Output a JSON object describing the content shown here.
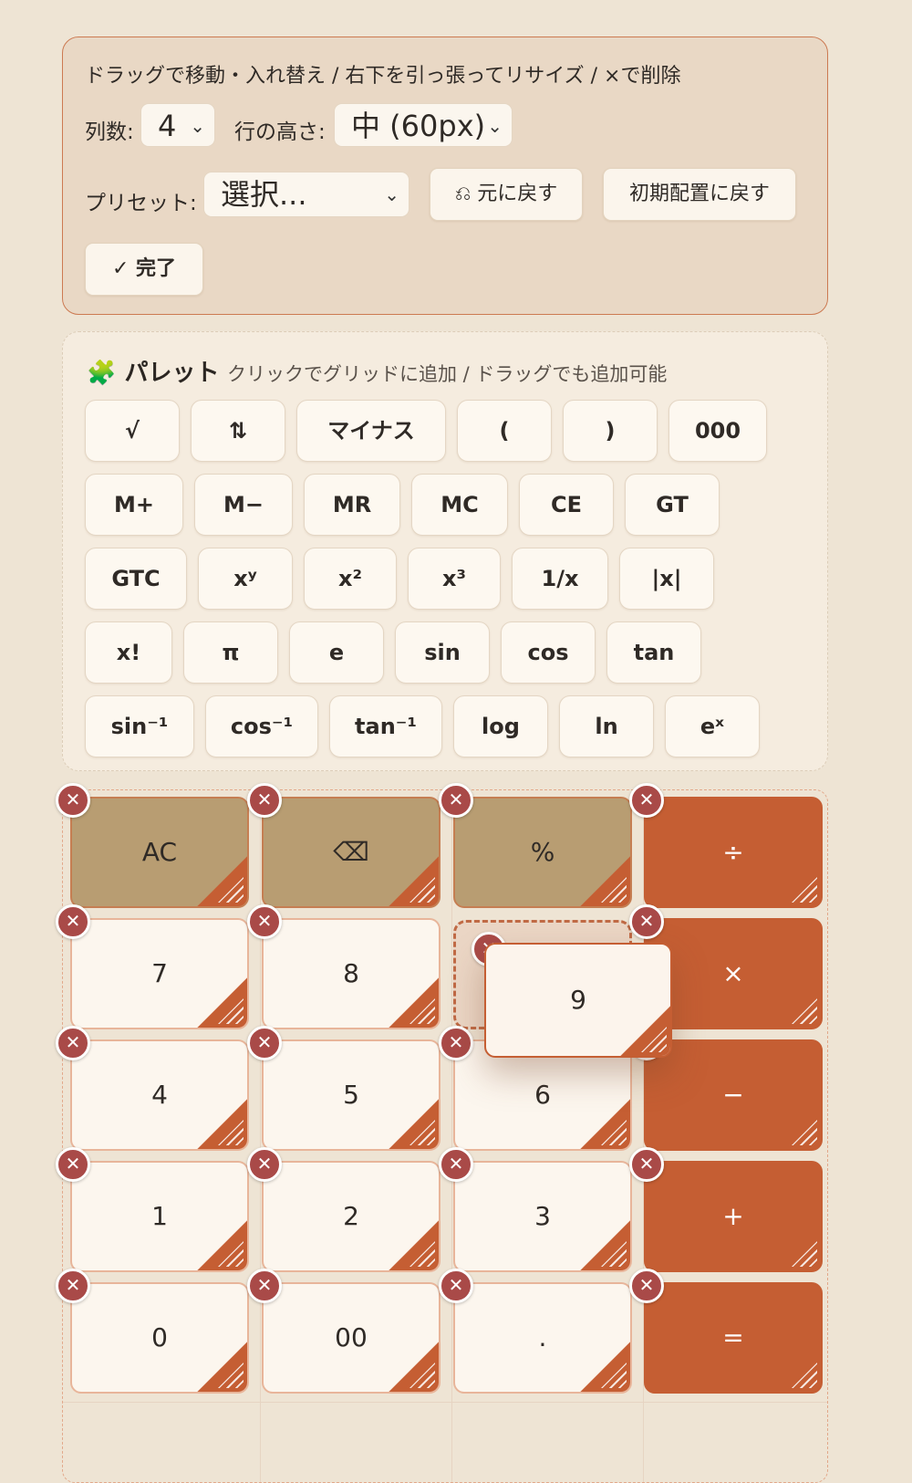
{
  "toolbar": {
    "hint": "ドラッグで移動・入れ替え / 右下を引っ張ってリサイズ / ×で削除",
    "columns_label": "列数:",
    "columns_value": "4",
    "row_height_label": "行の高さ:",
    "row_height_value": "中 (60px)",
    "preset_label": "プリセット:",
    "preset_value": "選択...",
    "undo_label": "⎌ 元に戻す",
    "reset_label": "初期配置に戻す",
    "done_label": "✓ 完了"
  },
  "palette": {
    "icon": "🧩",
    "title": "パレット",
    "subtitle": "クリックでグリッドに追加 / ドラッグでも追加可能",
    "rows": [
      [
        "√",
        "⇅",
        "マイナス",
        "(",
        ")",
        "000"
      ],
      [
        "M+",
        "M−",
        "MR",
        "MC",
        "CE",
        "GT"
      ],
      [
        "GTC",
        "xʸ",
        "x²",
        "x³",
        "1/x",
        "|x|"
      ],
      [
        "x!",
        "π",
        "e",
        "sin",
        "cos",
        "tan"
      ],
      [
        "sin⁻¹",
        "cos⁻¹",
        "tan⁻¹",
        "log",
        "ln",
        "eˣ"
      ]
    ]
  },
  "grid": {
    "rows": [
      [
        {
          "label": "AC",
          "kind": "fn"
        },
        {
          "label": "⌫",
          "kind": "fn"
        },
        {
          "label": "%",
          "kind": "fn"
        },
        {
          "label": "÷",
          "kind": "op"
        }
      ],
      [
        {
          "label": "7",
          "kind": "num"
        },
        {
          "label": "8",
          "kind": "num"
        },
        {
          "label": "",
          "kind": "slot"
        },
        {
          "label": "×",
          "kind": "op"
        }
      ],
      [
        {
          "label": "4",
          "kind": "num"
        },
        {
          "label": "5",
          "kind": "num"
        },
        {
          "label": "6",
          "kind": "num"
        },
        {
          "label": "−",
          "kind": "op"
        }
      ],
      [
        {
          "label": "1",
          "kind": "num"
        },
        {
          "label": "2",
          "kind": "num"
        },
        {
          "label": "3",
          "kind": "num"
        },
        {
          "label": "+",
          "kind": "op"
        }
      ],
      [
        {
          "label": "0",
          "kind": "num"
        },
        {
          "label": "00",
          "kind": "num"
        },
        {
          "label": ".",
          "kind": "num"
        },
        {
          "label": "=",
          "kind": "op"
        }
      ]
    ],
    "dragging_label": "9",
    "delete_glyph": "✕"
  },
  "colors": {
    "background": "#EEE4D4",
    "accent": "#C55E33",
    "function_key": "#B89D72",
    "delete": "#A94A48"
  },
  "icons": [
    "puzzle-icon",
    "undo-icon",
    "chevron-down-icon",
    "delete-icon",
    "resize-grip-icon"
  ]
}
